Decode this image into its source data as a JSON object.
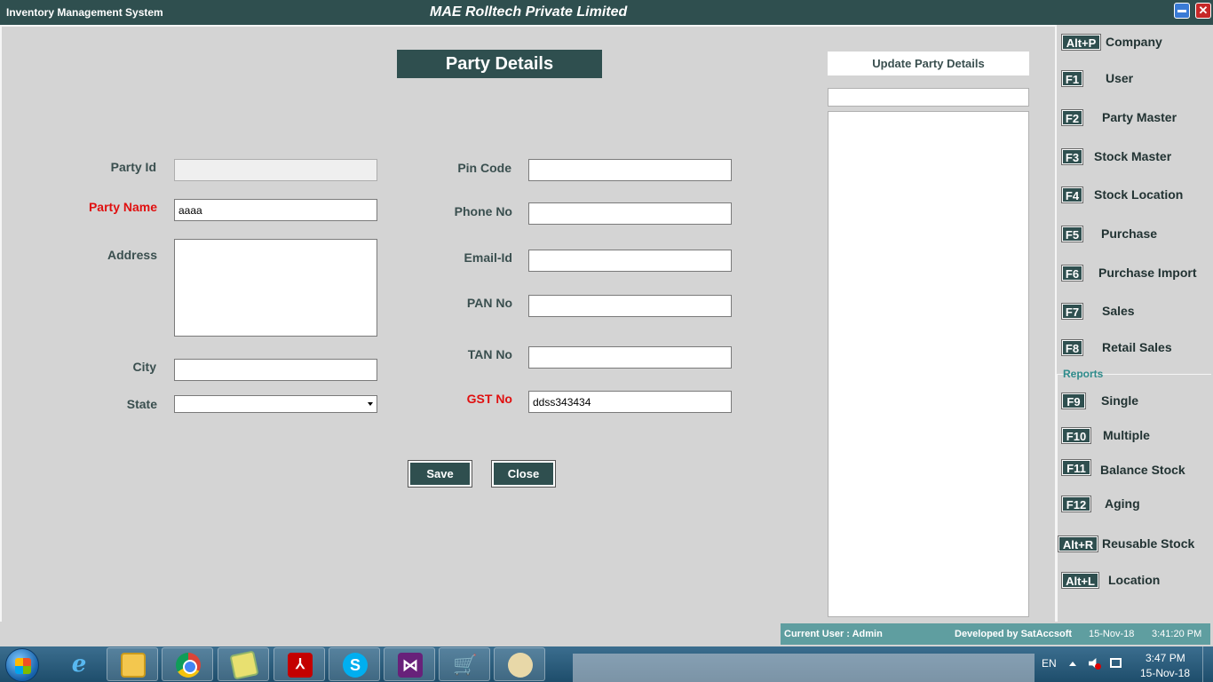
{
  "window": {
    "app_title": "Inventory Management System",
    "company_title": "MAE Rolltech Private Limited",
    "close_glyph": "✕"
  },
  "form": {
    "heading": "Party Details",
    "fields": {
      "party_id": {
        "label": "Party Id",
        "value": ""
      },
      "party_name": {
        "label": "Party Name",
        "value": "aaaa"
      },
      "address": {
        "label": "Address",
        "value": ""
      },
      "city": {
        "label": "City",
        "value": ""
      },
      "state": {
        "label": "State",
        "value": ""
      },
      "pin_code": {
        "label": "Pin Code",
        "value": ""
      },
      "phone_no": {
        "label": "Phone No",
        "value": ""
      },
      "email_id": {
        "label": "Email-Id",
        "value": ""
      },
      "pan_no": {
        "label": "PAN No",
        "value": ""
      },
      "tan_no": {
        "label": "TAN No",
        "value": ""
      },
      "gst_no": {
        "label": "GST No",
        "value": "ddss343434"
      }
    },
    "save_label": "Save",
    "close_label": "Close"
  },
  "update_panel": {
    "title": "Update Party Details",
    "search_value": ""
  },
  "menu": {
    "items": [
      {
        "key": "Alt+P",
        "label": "Company"
      },
      {
        "key": "F1",
        "label": "User"
      },
      {
        "key": "F2",
        "label": "Party Master"
      },
      {
        "key": "F3",
        "label": "Stock Master"
      },
      {
        "key": "F4",
        "label": "Stock Location"
      },
      {
        "key": "F5",
        "label": "Purchase"
      },
      {
        "key": "F6",
        "label": "Purchase Import"
      },
      {
        "key": "F7",
        "label": "Sales"
      },
      {
        "key": "F8",
        "label": "Retail Sales"
      }
    ],
    "reports_label": "Reports",
    "reports": [
      {
        "key": "F9",
        "label": "Single"
      },
      {
        "key": "F10",
        "label": "Multiple"
      },
      {
        "key": "F11",
        "label": "Balance Stock"
      },
      {
        "key": "F12",
        "label": "Aging"
      },
      {
        "key": "Alt+R",
        "label": "Reusable Stock"
      },
      {
        "key": "Alt+L",
        "label": "Location"
      }
    ]
  },
  "status_bar": {
    "current_user": "Current User : Admin",
    "developer": "Developed by SatAccsoft",
    "date": "15-Nov-18",
    "time": "3:41:20 PM"
  },
  "taskbar": {
    "apps": [
      "internet-explorer",
      "file-explorer",
      "chrome",
      "sticky-notes",
      "acrobat-reader",
      "skype",
      "visual-studio",
      "shopping-cart-app",
      "paint"
    ],
    "language": "EN",
    "clock_time": "3:47 PM",
    "clock_date": "15-Nov-18"
  },
  "colors": {
    "accent": "#2f4f4f",
    "required_label": "#e01010",
    "status_bar": "#5f9ea0"
  }
}
